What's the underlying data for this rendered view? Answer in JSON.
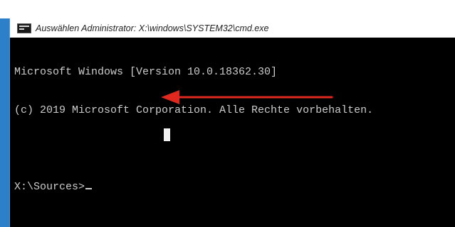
{
  "window": {
    "title": "Auswählen Administrator: X:\\windows\\SYSTEM32\\cmd.exe",
    "icon": "cmd-console-icon"
  },
  "console": {
    "lines": [
      "Microsoft Windows [Version 10.0.18362.30]",
      "(c) 2019 Microsoft Corporation. Alle Rechte vorbehalten.",
      "",
      "X:\\Sources>"
    ]
  },
  "annotation": {
    "arrow_icon": "red-arrow-left-icon",
    "arrow_color": "#e0281e"
  },
  "colors": {
    "console_bg": "#000000",
    "console_text": "#cccccc",
    "desktop": "#2c7fc9"
  }
}
